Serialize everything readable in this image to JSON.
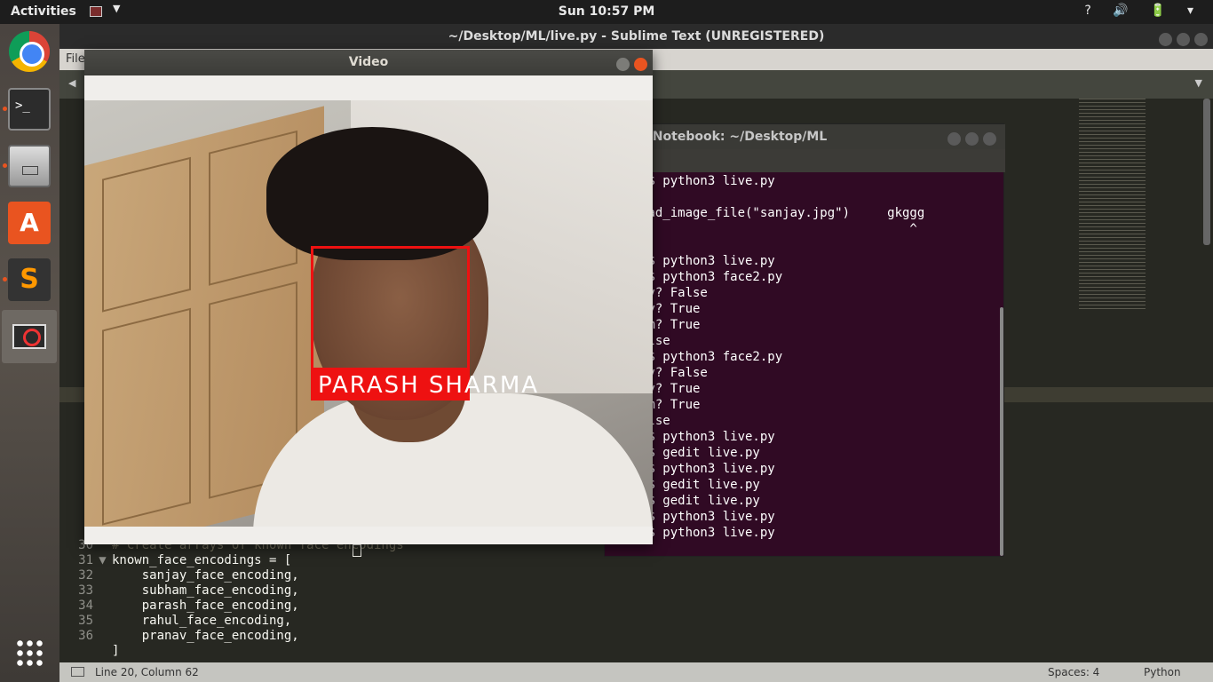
{
  "topbar": {
    "activities": "Activities",
    "clock": "Sun 10:57 PM",
    "tray": "? 🔊 🔋 ▾"
  },
  "sublime": {
    "title": "~/Desktop/ML/live.py - Sublime Text (UNREGISTERED)",
    "menu_first": "File",
    "code": [
      {
        "num": "30",
        "fold": "",
        "text": "# Create arrays of known face encodings",
        "comment": true
      },
      {
        "num": "31",
        "fold": "▼",
        "text": "known_face_encodings = [",
        "comment": false
      },
      {
        "num": "32",
        "fold": "",
        "text": "    sanjay_face_encoding,",
        "comment": false
      },
      {
        "num": "33",
        "fold": "",
        "text": "    subham_face_encoding,",
        "comment": false
      },
      {
        "num": "34",
        "fold": "",
        "text": "    parash_face_encoding,",
        "comment": false
      },
      {
        "num": "35",
        "fold": "",
        "text": "    rahul_face_encoding,",
        "comment": false
      },
      {
        "num": "36",
        "fold": "",
        "text": "    pranav_face_encoding,",
        "comment": false
      },
      {
        "num": "",
        "fold": "",
        "text": "]",
        "comment": false
      }
    ],
    "status": {
      "position": "Line 20, Column 62",
      "spaces": "Spaces: 4",
      "syntax": "Python"
    }
  },
  "terminal": {
    "title": "-Notebook: ~/Desktop/ML",
    "lines": [
      ":$ python3 live.py",
      "",
      "oad_image_file(\"sanjay.jpg\")     gkggg",
      "                                    ^",
      "",
      ":$ python3 live.py",
      ":$ python3 face2.py",
      "av? False",
      "ay? True",
      "am? True",
      "alse",
      ":$ python3 face2.py",
      "av? False",
      "ay? True",
      "am? True",
      "alse",
      ":$ python3 live.py",
      ":$ gedit live.py",
      ":$ python3 live.py",
      ":$ gedit live.py",
      ":$ gedit live.py",
      ":$ python3 live.py",
      ":$ python3 live.py"
    ]
  },
  "video": {
    "title": "Video",
    "face_label": "PARASH SHARMA",
    "box_color": "#ee1111"
  },
  "icons": [
    "chrome-icon",
    "terminal-icon",
    "files-icon",
    "software-store-icon",
    "sublime-text-icon",
    "video-window-icon",
    "show-apps-icon"
  ]
}
